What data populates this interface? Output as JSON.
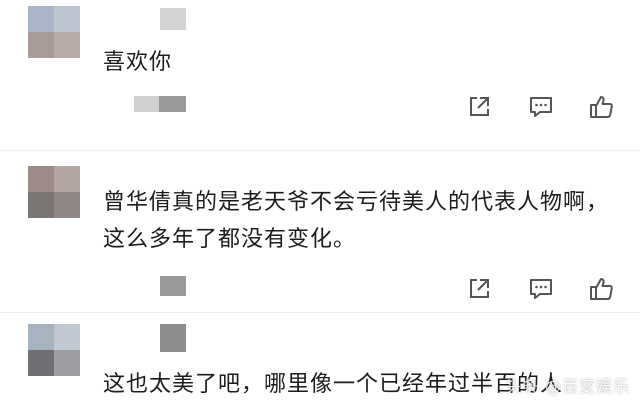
{
  "comments": [
    {
      "text": "喜欢你"
    },
    {
      "text": "曾华倩真的是老天爷不会亏待美人的代表人物啊，这么多年了都没有变化。"
    },
    {
      "text": "这也太美了吧，哪里像一个已经年过半百的人"
    }
  ],
  "actions": {
    "share_icon": "share-icon",
    "comment_icon": "comment-icon",
    "like_icon": "thumbs-up-icon"
  },
  "watermark": "头条 @百变娱乐",
  "colors": {
    "text": "#1c1c1c",
    "icon": "#555555",
    "background": "#ffffff"
  }
}
